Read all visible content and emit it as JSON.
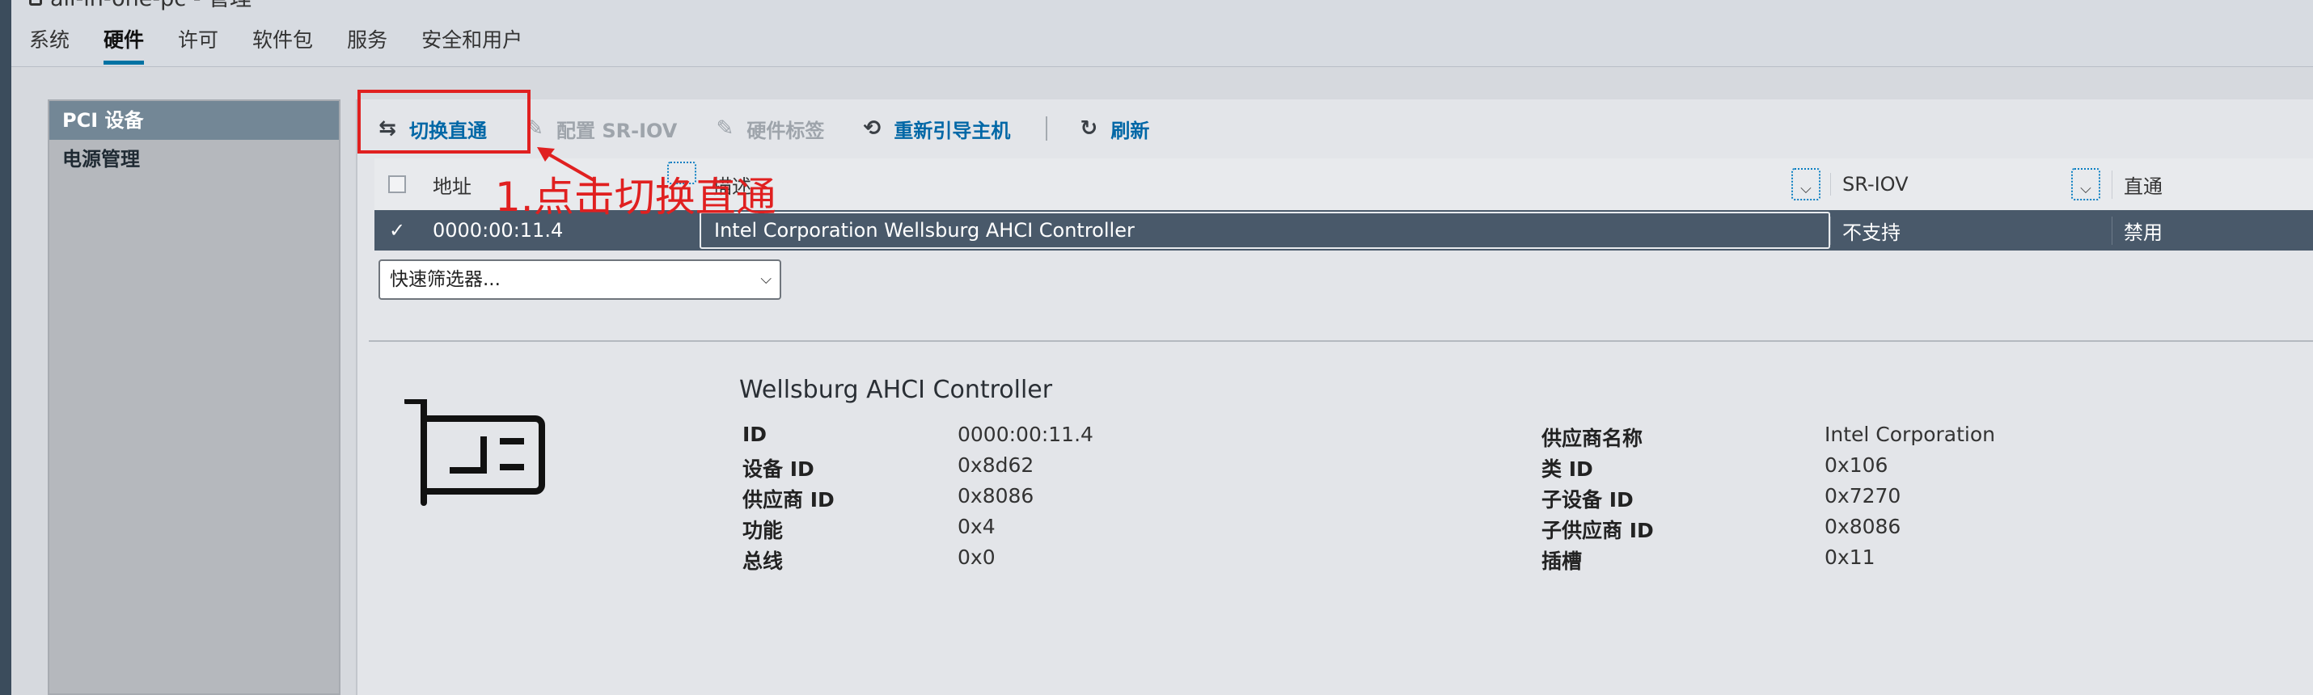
{
  "header": {
    "host_title": "all-in-one-pc - 管理",
    "tabs": [
      "系统",
      "硬件",
      "许可",
      "软件包",
      "服务",
      "安全和用户"
    ],
    "active_tab": "硬件"
  },
  "sidebar": {
    "items": [
      {
        "label": "PCI 设备",
        "active": true
      },
      {
        "label": "电源管理",
        "active": false
      }
    ]
  },
  "toolbar": {
    "toggle_passthrough": "切换直通",
    "configure_sriov": "配置 SR-IOV",
    "hardware_label": "硬件标签",
    "reboot_host": "重新引导主机",
    "refresh": "刷新"
  },
  "grid": {
    "columns": {
      "address": "地址",
      "description": "描述",
      "sriov": "SR-IOV",
      "passthrough": "直通"
    },
    "rows": [
      {
        "selected": true,
        "address": "0000:00:11.4",
        "description": "Intel Corporation Wellsburg AHCI Controller",
        "sriov": "不支持",
        "passthrough": "禁用"
      }
    ],
    "filter_placeholder": "快速筛选器..."
  },
  "details": {
    "title": "Wellsburg AHCI Controller",
    "left": [
      {
        "label": "ID",
        "value": "0000:00:11.4"
      },
      {
        "label": "设备 ID",
        "value": "0x8d62"
      },
      {
        "label": "供应商 ID",
        "value": "0x8086"
      },
      {
        "label": "功能",
        "value": "0x4"
      },
      {
        "label": "总线",
        "value": "0x0"
      }
    ],
    "right": [
      {
        "label": "供应商名称",
        "value": "Intel Corporation"
      },
      {
        "label": "类 ID",
        "value": "0x106"
      },
      {
        "label": "子设备 ID",
        "value": "0x7270"
      },
      {
        "label": "子供应商 ID",
        "value": "0x8086"
      },
      {
        "label": "插槽",
        "value": "0x11"
      }
    ]
  },
  "annotation": {
    "text": "1.点击切换直通",
    "color": "#e02020"
  },
  "colors": {
    "accent": "#0072a3",
    "link": "#0067a6",
    "selected_row": "#49596a"
  }
}
